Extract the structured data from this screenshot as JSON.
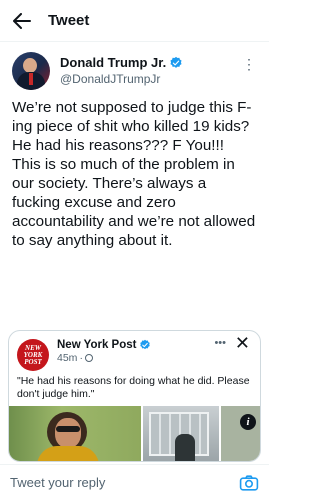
{
  "topbar": {
    "back_icon": "arrow-left-icon",
    "title": "Tweet"
  },
  "tweet": {
    "author_name": "Donald Trump Jr.",
    "author_handle": "@DonaldJTrumpJr",
    "verified": true,
    "text": "We’re not supposed to judge this F-ing piece of shit who killed 19 kids? He had his reasons??? F You!!!\nThis is so much of the problem in our society. There’s always a fucking excuse and zero accountability and we’re not allowed to say anything about it."
  },
  "quoted": {
    "logo_lines": [
      "NEW",
      "YORK",
      "POST"
    ],
    "author_name": "New York Post",
    "verified": true,
    "time": "45m",
    "separator": "·",
    "text": "\"He had his reasons for doing what he did. Please don't judge him.\"",
    "more_label": "•••",
    "close_label": "✕",
    "info_label": "i"
  },
  "reply": {
    "placeholder": "Tweet your reply",
    "camera_icon": "camera-icon"
  },
  "colors": {
    "verified_blue": "#1d9bf0",
    "nyp_red": "#c4161c",
    "secondary_text": "#536471"
  }
}
